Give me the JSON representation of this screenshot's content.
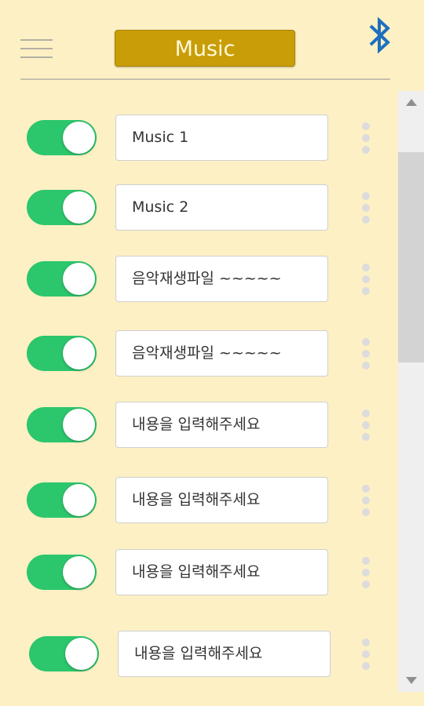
{
  "header": {
    "title": "Music",
    "title_color": "#c99d07",
    "left_icon": "hamburger-menu-icon",
    "right_icon": "bluetooth-icon",
    "bluetooth_color": "#1e6fbf"
  },
  "toggle_color": "#2cc66c",
  "items": [
    {
      "enabled": true,
      "text": "Music 1"
    },
    {
      "enabled": true,
      "text": "Music  2"
    },
    {
      "enabled": true,
      "text": "음악재생파일 ~~~~~"
    },
    {
      "enabled": true,
      "text": "음악재생파일 ~~~~~"
    },
    {
      "enabled": true,
      "text": "내용을 입력해주세요"
    },
    {
      "enabled": true,
      "text": "내용을 입력해주세요"
    },
    {
      "enabled": true,
      "text": "내용을 입력해주세요"
    },
    {
      "enabled": true,
      "text": "내용을 입력해주세요"
    }
  ]
}
